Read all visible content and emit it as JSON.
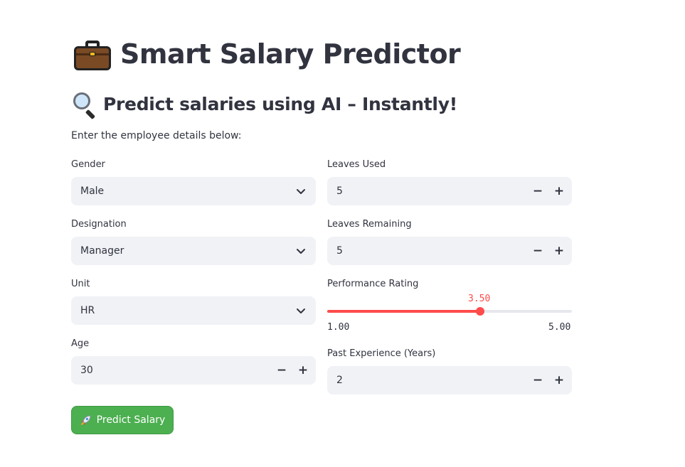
{
  "title": "Smart Salary Predictor",
  "subtitle": "Predict salaries using AI – Instantly!",
  "intro": "Enter the employee details below:",
  "fields": {
    "gender": {
      "label": "Gender",
      "value": "Male"
    },
    "designation": {
      "label": "Designation",
      "value": "Manager"
    },
    "unit": {
      "label": "Unit",
      "value": "HR"
    },
    "age": {
      "label": "Age",
      "value": "30"
    },
    "leaves_used": {
      "label": "Leaves Used",
      "value": "5"
    },
    "leaves_remaining": {
      "label": "Leaves Remaining",
      "value": "5"
    },
    "performance": {
      "label": "Performance Rating",
      "value": 3.5,
      "value_text": "3.50",
      "min": 1.0,
      "max": 5.0,
      "min_text": "1.00",
      "max_text": "5.00"
    },
    "experience": {
      "label": "Past Experience (Years)",
      "value": "2"
    }
  },
  "stepper": {
    "minus": "−",
    "plus": "+"
  },
  "button": {
    "label": "Predict Salary"
  },
  "icons": {
    "title": "briefcase-icon",
    "subtitle": "magnifying-glass-icon",
    "dropdown": "chevron-down-icon",
    "button": "rocket-icon"
  },
  "colors": {
    "accent": "#ff4b4b",
    "button": "#4caf50",
    "field_bg": "#f0f2f6",
    "text": "#31333f"
  }
}
